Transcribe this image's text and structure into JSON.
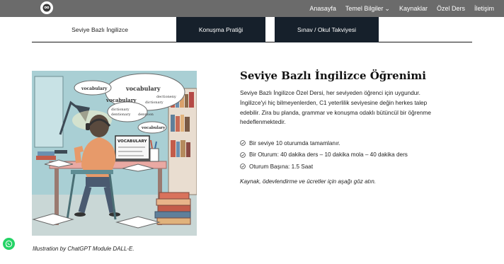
{
  "nav": {
    "items": [
      "Anasayfa",
      "Temel Bilgiler",
      "Kaynaklar",
      "Özel Ders",
      "İletişim"
    ]
  },
  "tabs": [
    "Seviye Bazlı İngilizce",
    "Konuşma Pratiği",
    "Sınav / Okul Takviyesi"
  ],
  "illustration": {
    "words": [
      "VOCABULARY",
      "vocabulary",
      "vocabulary",
      "vocabulary",
      "dictionary",
      "dectioneny",
      "dictionary",
      "dentionary",
      "dennoon",
      "vocabulary",
      "vocabulary"
    ],
    "caption": "Illustration by ChatGPT Module DALL-E."
  },
  "content": {
    "title": "Seviye Bazlı İngilizce Öğrenimi",
    "paragraph": "Seviye Bazlı İngilizce Özel Dersi, her seviyeden öğrenci için uygundur. İngilizce'yi hiç bilmeyenlerden, C1 yeterlilik seviyesine değin herkes talep edebilir. Zira bu planda, grammar ve konuşma odaklı bütüncül bir öğrenme hedeflenmektedir.",
    "list": [
      "Bir seviye 10 oturumda tamamlanır.",
      "Bir Oturum: 40 dakika ders – 10 dakika mola – 40 dakika ders",
      "Oturum Başına: 1.5 Saat"
    ],
    "note": "Kaynak, ödevlendirme ve ücretler için aşağı göz atın."
  },
  "colors": {
    "topbar": "#6b6b6b",
    "tab_dark": "#16202b",
    "whatsapp": "#25d366"
  }
}
